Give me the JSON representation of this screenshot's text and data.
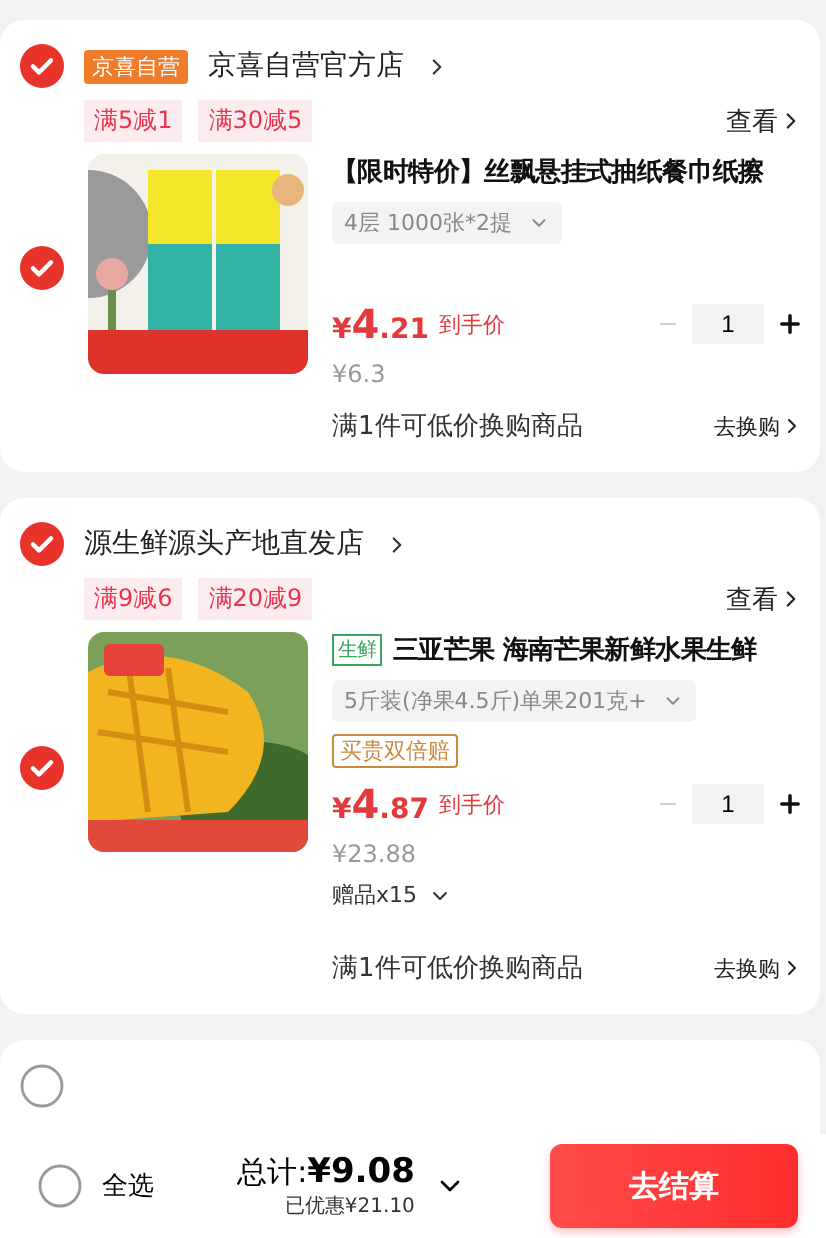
{
  "shops": [
    {
      "name": "京喜自营官方店",
      "badge": "京喜自营",
      "selected": true,
      "coupons": [
        "满5减1",
        "满30减5"
      ],
      "view": "查看",
      "item": {
        "kind": "tissue",
        "title": "【限时特价】丝飘悬挂式抽纸餐巾纸擦",
        "spec": "4层 1000张*2提",
        "price": "¥4.21",
        "price_label": "到手价",
        "original": "¥6.3",
        "quantity": "1"
      },
      "exchange": "满1件可低价换购商品",
      "exchange_link": "去换购"
    },
    {
      "name": "源生鲜源头产地直发店",
      "selected": true,
      "coupons": [
        "满9减6",
        "满20减9"
      ],
      "view": "查看",
      "item": {
        "kind": "mango",
        "tag": "生鲜",
        "title": "三亚芒果 海南芒果新鲜水果生鲜",
        "spec": "5斤装(净果4.5斤)单果201克+",
        "service": "买贵双倍赔",
        "price": "¥4.87",
        "price_label": "到手价",
        "original": "¥23.88",
        "quantity": "1",
        "gift": "赠品x15"
      },
      "exchange": "满1件可低价换购商品",
      "exchange_link": "去换购"
    },
    {
      "selected": false
    }
  ],
  "footer": {
    "select_all": "全选",
    "select_all_checked": false,
    "total_label": "总计:",
    "total": "¥9.08",
    "saved": "已优惠¥21.10",
    "checkout": "去结算"
  }
}
